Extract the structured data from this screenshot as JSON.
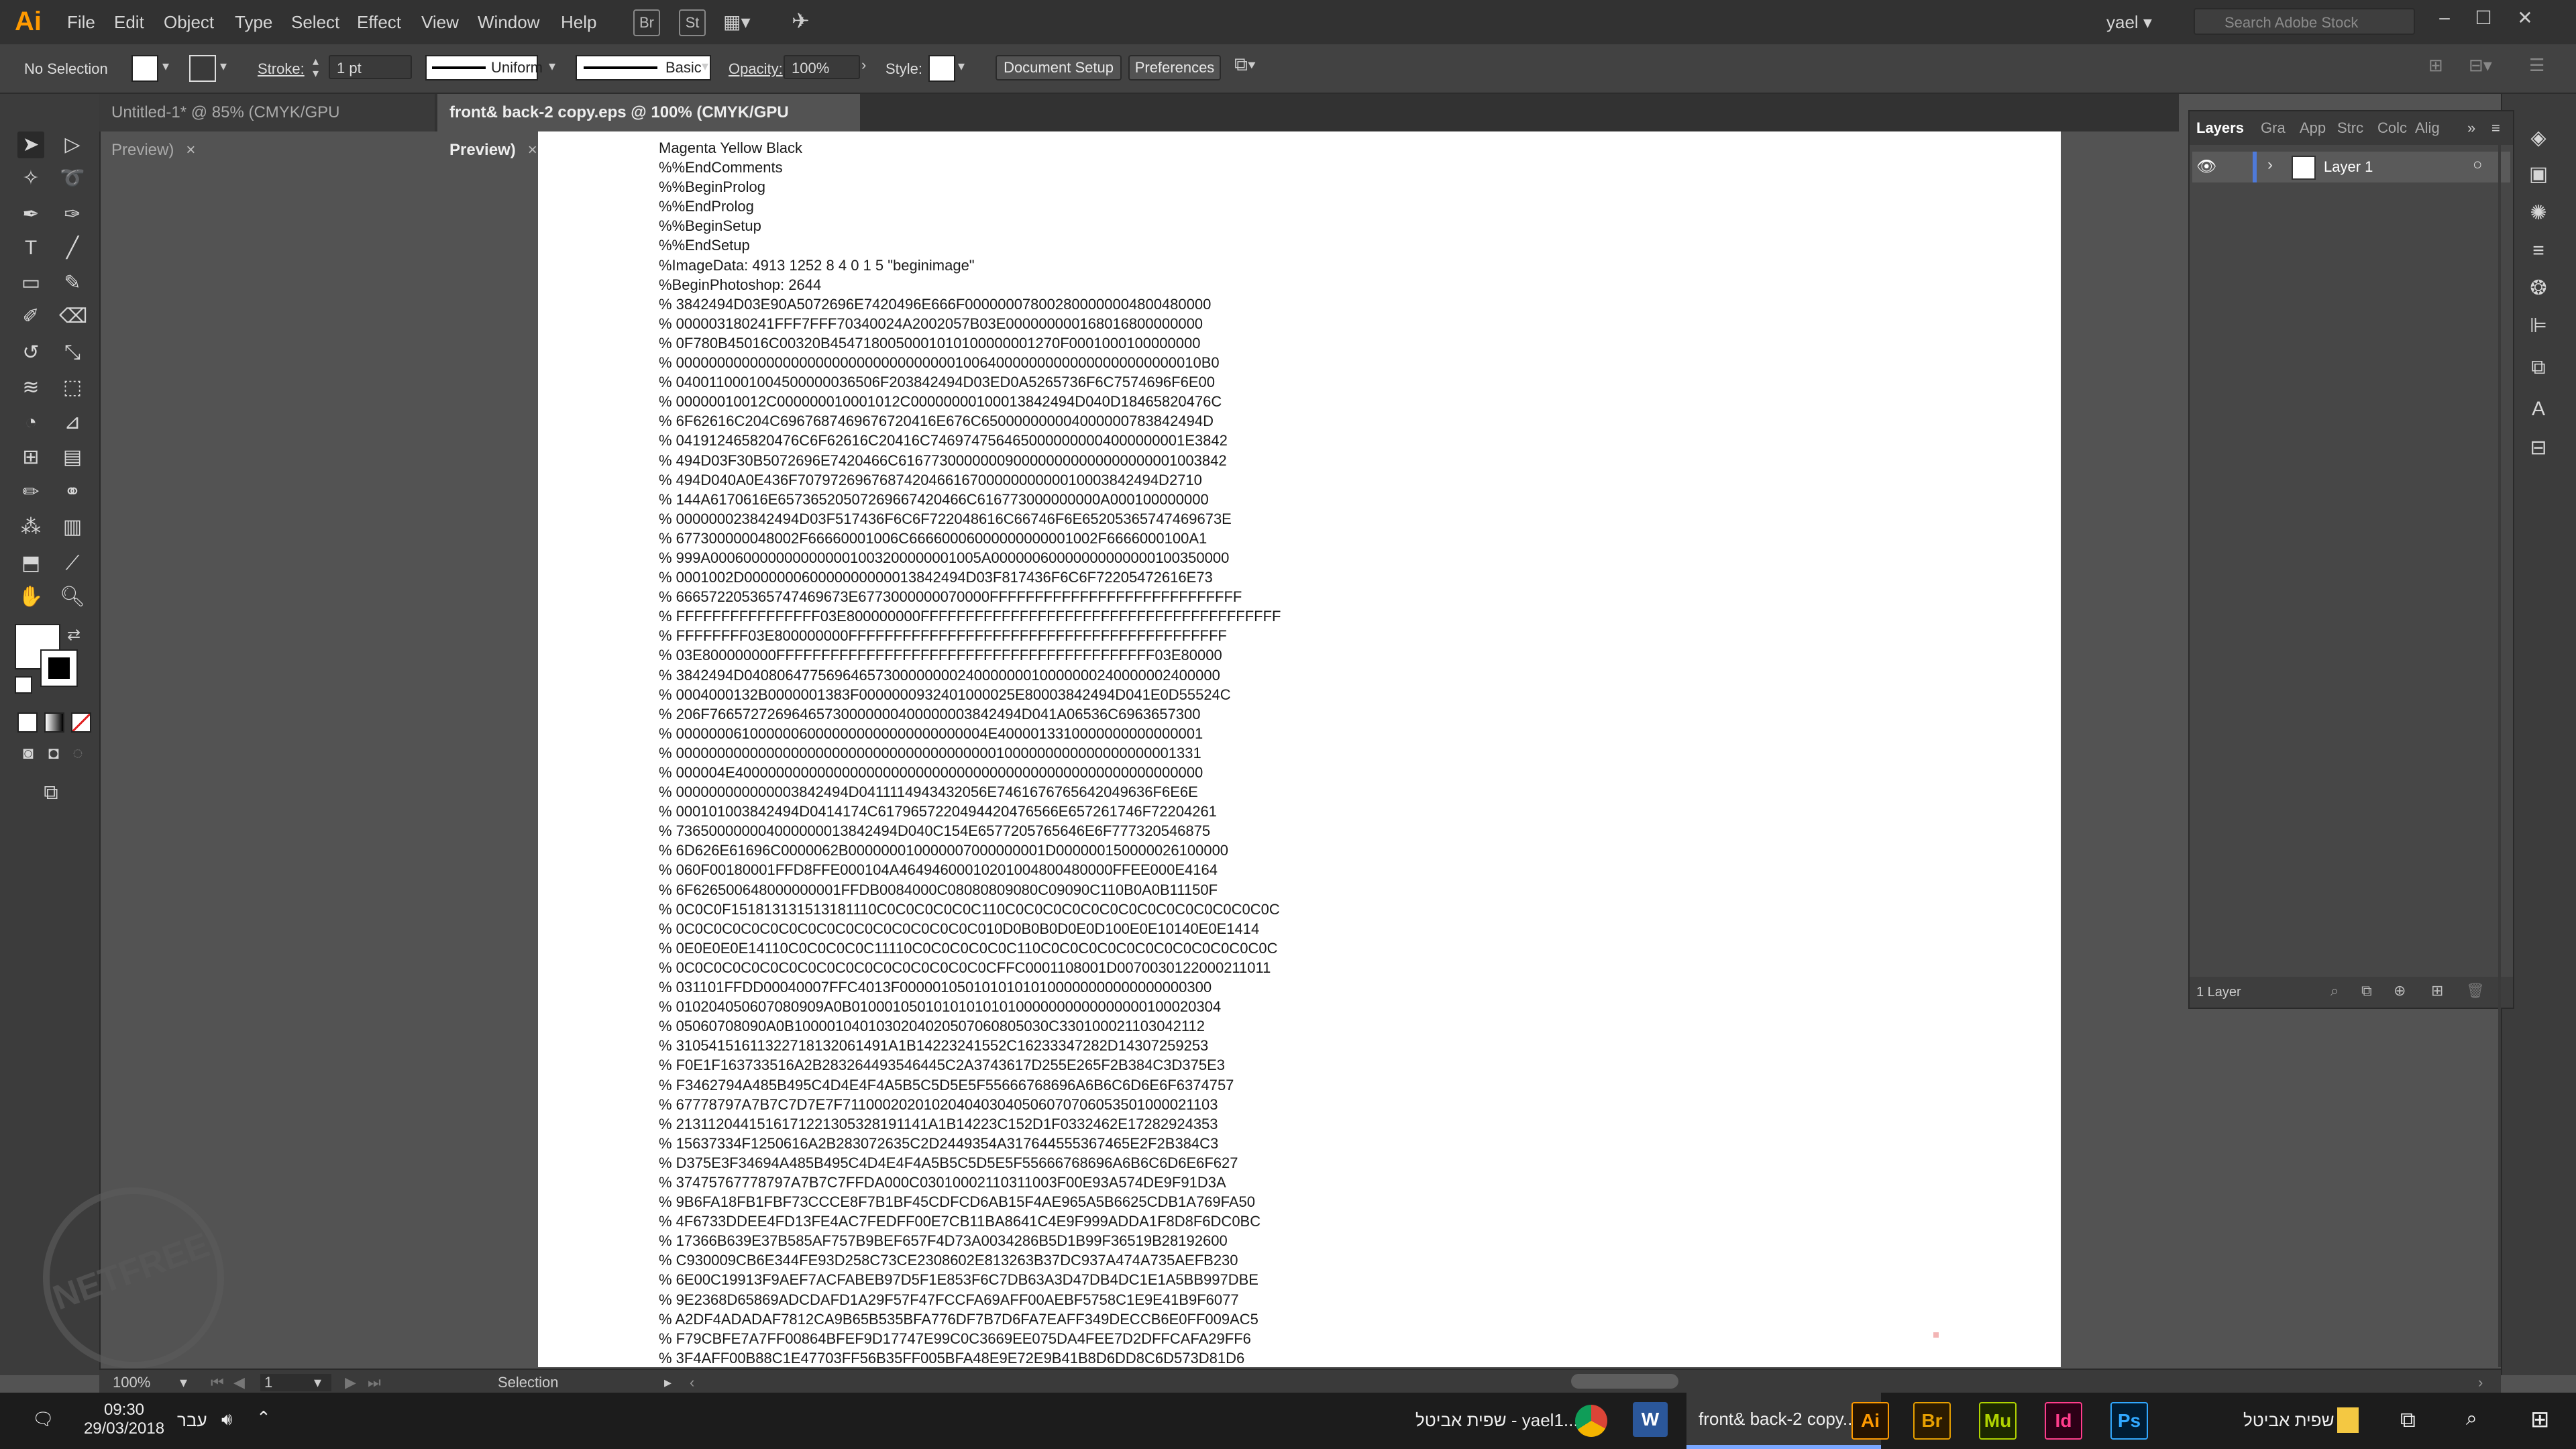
{
  "app": {
    "logo_text": "Ai"
  },
  "menu": [
    "File",
    "Edit",
    "Object",
    "Type",
    "Select",
    "Effect",
    "View",
    "Window",
    "Help"
  ],
  "bridge_buttons": [
    "Br",
    "St"
  ],
  "user": {
    "name": "yael"
  },
  "stock_search": {
    "placeholder": "Search Adobe Stock"
  },
  "control_bar": {
    "selection": "No Selection",
    "stroke_label": "Stroke:",
    "stroke_value": "1 pt",
    "profile": "Uniform",
    "brush": "Basic",
    "opacity_label": "Opacity:",
    "opacity_value": "100%",
    "style_label": "Style:",
    "document_setup": "Document Setup",
    "preferences": "Preferences"
  },
  "tabs": [
    {
      "label": "Untitled-1* @ 85% (CMYK/GPU Preview)",
      "close": "×",
      "active": false
    },
    {
      "label": "front& back-2 copy.eps @ 100% (CMYK/GPU Preview)",
      "close": "×",
      "active": true
    }
  ],
  "document_lines": [
    "Magenta Yellow Black",
    "%%EndComments",
    "%%BeginProlog",
    "%%EndProlog",
    "%%BeginSetup",
    "%%EndSetup",
    "%ImageData: 4913 1252 8 4 0 1 5 \"beginimage\"",
    "%BeginPhotoshop: 2644",
    "% 3842494D03E90A5072696E7420496E666F000000078002800000004800480000",
    "% 000003180241FFF7FFF70340024A2002057B03E000000000168016800000000",
    "% 0F780B45016C00320B4547180050001010100000001270F0001000100000000",
    "% 0000000000000000000000000000000000100640000000000000000000000010B0",
    "% 0400110001004500000036506F203842494D03ED0A5265736F6C7574696F6E00",
    "% 00000010012C000000010001012C00000000100013842494D040D18465820476C",
    "% 6F62616C204C6967687469676720416E676C650000000004000000783842494D",
    "% 041912465820476C6F62616C20416C7469747564650000000004000000001E3842",
    "% 494D03F30B5072696E7420466C6167730000000900000000000000000001003842",
    "% 494D040A0E436F70797269676874204661670000000000010003842494D2710",
    "% 144A6170616E65736520507269667420466C616773000000000A000100000000",
    "% 000000023842494D03F517436F6C6F722048616C66746F6E65205365747469673E",
    "% 677300000048002F66660001006C66660006000000000001002F6666000100A1",
    "% 999A000600000000000001003200000001005A00000060000000000000100350000",
    "% 0001002D000000060000000000013842494D03F817436F6C6F72205472616E73",
    "% 666572205365747469673E6773000000070000FFFFFFFFFFFFFFFFFFFFFFFFFFFF",
    "% FFFFFFFFFFFFFFFF03E800000000FFFFFFFFFFFFFFFFFFFFFFFFFFFFFFFFFFFFFFFF",
    "% FFFFFFFF03E800000000FFFFFFFFFFFFFFFFFFFFFFFFFFFFFFFFFFFFFFFFFF",
    "% 03E800000000FFFFFFFFFFFFFFFFFFFFFFFFFFFFFFFFFFFFFFFFFF03E80000",
    "% 3842494D0408064775696465730000000024000000010000000240000002400000",
    "% 0004000132B0000001383F0000000932401000025E80003842494D041E0D55524C",
    "% 206F76657272696465730000000400000003842494D041A06536C6963657300",
    "% 00000006100000060000000000000000000004E4000013310000000000000001",
    "% 0000000000000000000000000000000000000001000000000000000000001331",
    "% 000004E400000000000000000000000000000000000000000000000000000000",
    "% 000000000000003842494D0411114943432056E7461676765642049636F6E6E",
    "% 000101003842494D0414174C6179657220494420476566E657261746F72204261",
    "% 736500000004000000013842494D040C154E6577205765646E6F777320546875",
    "% 6D626E61696C0000062B000000010000007000000001D000000150000026100000",
    "% 060F00180001FFD8FFE000104A46494600010201004800480000FFEE000E4164",
    "% 6F626500648000000001FFDB0084000C08080809080C09090C110B0A0B11150F",
    "% 0C0C0F151813131513181110C0C0C0C0C0C110C0C0C0C0C0C0C0C0C0C0C0C0C0C0C",
    "% 0C0C0C0C0C0C0C0C0C0C0C0C0C0C0C0C010D0B0B0D0E0D100E0E10140E0E1414",
    "% 0E0E0E0E14110C0C0C0C0C11110C0C0C0C0C0C110C0C0C0C0C0C0C0C0C0C0C0C0C",
    "% 0C0C0C0C0C0C0C0C0C0C0C0C0C0C0C0C0CFFC0001108001D0070030122000211011",
    "% 031101FFDD00040007FFC4013F00000105010101010100000000000000000300",
    "% 010204050607080909A0B010001050101010101010000000000000000100020304",
    "% 05060708090A0B1000010401030204020507060805030C330100021103042112",
    "% 31054151611322718132061491A1B14223241552C16233347282D14307259253",
    "% F0E1F163733516A2B283264493546445C2A3743617D255E265F2B384C3D375E3",
    "% F3462794A485B495C4D4E4F4A5B5C5D5E5F55666768696A6B6C6D6E6F6374757",
    "% 67778797A7B7C7D7E7F7110002020102040403040506070706053501000021103",
    "% 2131120441516171221305328191141A1B14223C152D1F0332462E17282924353",
    "% 15637334F1250616A2B283072635C2D2449354A317644555367465E2F2B384C3",
    "% D375E3F34694A485B495C4D4E4F4A5B5C5D5E5F55666768696A6B6C6D6E6F627",
    "% 37475767778797A7B7C7FFDA000C03010002110311003F00E93A574DE9F91D3A",
    "% 9B6FA18FB1FBF73CCCE8F7B1BF45CDFCD6AB15F4AE965A5B6625CDB1A769FA50",
    "% 4F6733DDEE4FD13FE4AC7FEDFF00E7CB11BA8641C4E9F999ADDA1F8D8F6DC0BC",
    "% 17366B639E37B585AF757B9BEF657F4D73A0034286B5D1B99F36519B28192600",
    "% C930009CB6E344FE93D258C73CE2308602E813263B37DC937A474A735AEFB230",
    "% 6E00C19913F9AEF7ACFABEB97D5F1E853F6C7DB63A3D47DB4DC1E1A5BB997DBE",
    "% 9E2368D65869ADCDAFD1A29F57F47FCCFA69AFF00AEBF5758C1E9E41B9F6077",
    "% A2DF4ADADAF7812CA9B65B535BFA776DF7B7D6FA7EAFF349DECCB6E0FF009AC5",
    "% F79CBFE7A7FF00864BFEF9D17747E99C0C3669EE075DA4FEE7D2DFFCAFA29FF6",
    "% 3F4AFF00B88C1E47703FF56B35FF005BFA48E9E72E9B41B8D6DD8C6D573D81D6"
  ],
  "layers_panel": {
    "tabs": [
      "Layers",
      "Gra",
      "App",
      "Strc",
      "Colc",
      "Alig"
    ],
    "layer_name": "Layer 1",
    "footer": "1 Layer"
  },
  "status_bar": {
    "zoom": "100%",
    "page": "1",
    "tool": "Selection"
  },
  "taskbar": {
    "time": "09:30",
    "date": "29/03/2018",
    "language": "עבר",
    "chrome_window": "שפית אביטל - yael1...",
    "ai_window": "front& back-2 copy...",
    "folder_label": "שפית אביטל",
    "apps": [
      "W",
      "Ai",
      "Br",
      "Mu",
      "Id",
      "Ps"
    ]
  },
  "watermark_text": "NETFREE"
}
